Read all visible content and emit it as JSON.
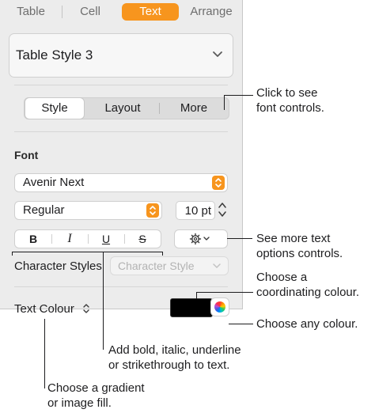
{
  "tabs": [
    {
      "label": "Table",
      "active": false
    },
    {
      "label": "Cell",
      "active": false
    },
    {
      "label": "Text",
      "active": true
    },
    {
      "label": "Arrange",
      "active": false
    }
  ],
  "style_box": {
    "label": "Table Style 3",
    "icon": "chevron-down-icon"
  },
  "segments": [
    {
      "label": "Style",
      "active": true
    },
    {
      "label": "Layout",
      "active": false
    },
    {
      "label": "More",
      "active": false
    }
  ],
  "font": {
    "heading": "Font",
    "family": "Avenir Next",
    "typeface": "Regular",
    "size": "10 pt",
    "format_buttons": [
      "B",
      "I",
      "U",
      "S"
    ]
  },
  "character_styles": {
    "label": "Character Styles",
    "placeholder": "Character Style"
  },
  "text_colour": {
    "label": "Text Colour",
    "swatch_color": "#000000"
  },
  "accent_color": "#f7951e",
  "callouts": {
    "font_controls": [
      "Click to see",
      "font controls."
    ],
    "text_options": [
      "See more text",
      "options controls."
    ],
    "coordinating": [
      "Choose a",
      "coordinating colour."
    ],
    "any_colour": "Choose any colour.",
    "bius": [
      "Add bold, italic, underline",
      "or strikethrough to text."
    ],
    "gradient": [
      "Choose a gradient",
      "or image fill."
    ]
  }
}
